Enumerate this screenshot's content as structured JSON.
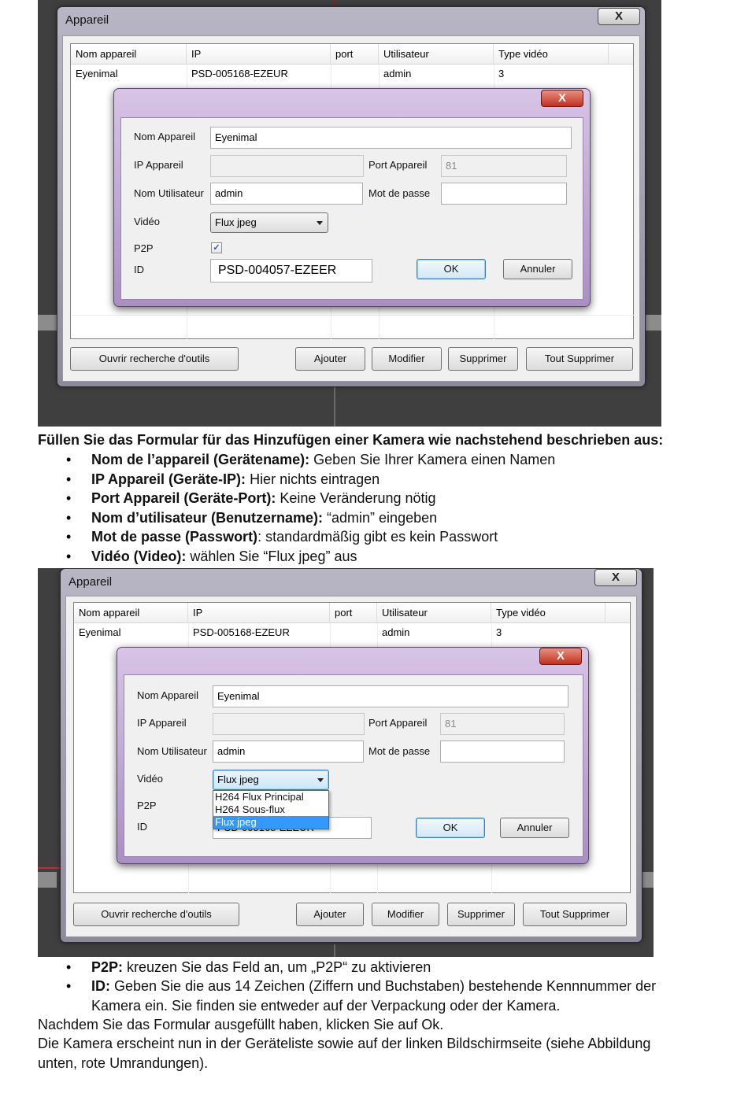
{
  "shot1": {
    "main_window": {
      "title": "Appareil",
      "close_glyph": "X",
      "columns": [
        "Nom appareil",
        "IP",
        "port",
        "Utilisateur",
        "Type vidéo"
      ],
      "row": [
        "Eyenimal",
        "PSD-005168-EZEUR",
        "",
        "admin",
        "3"
      ],
      "buttons": {
        "search": "Ouvrir recherche d'outils",
        "add": "Ajouter",
        "modify": "Modifier",
        "delete": "Supprimer",
        "delete_all": "Tout Supprimer"
      }
    },
    "dialog": {
      "close_glyph": "X",
      "labels": {
        "name": "Nom Appareil",
        "ip": "IP Appareil",
        "port": "Port Appareil",
        "user": "Nom Utilisateur",
        "password": "Mot de passe",
        "video": "Vidéo",
        "p2p": "P2P",
        "id": "ID"
      },
      "values": {
        "name": "Eyenimal",
        "ip": "",
        "port": "81",
        "user": "admin",
        "password": "",
        "video": "Flux jpeg",
        "p2p_checked": "✓",
        "id": "PSD-004057-EZEER"
      },
      "buttons": {
        "ok": "OK",
        "cancel": "Annuler"
      }
    }
  },
  "instructions": {
    "intro": "Füllen Sie das Formular für das Hinzufügen einer Kamera wie nachstehend beschrieben aus:",
    "bullet_glyph": "•",
    "items": [
      {
        "bold": "Nom de l’appareil (Gerätename):",
        "rest": " Geben Sie Ihrer Kamera einen Namen"
      },
      {
        "bold": "IP Appareil (Geräte-IP):",
        "rest": " Hier nichts eintragen"
      },
      {
        "bold": "Port Appareil (Geräte-Port):",
        "rest": " Keine Veränderung nötig"
      },
      {
        "bold": "Nom d’utilisateur (Benutzername):",
        "rest": " “admin” eingeben"
      },
      {
        "bold": "Mot de passe (Passwort)",
        "rest": ": standardmäßig gibt es kein Passwort"
      },
      {
        "bold": "Vidéo (Video):",
        "rest": " wählen Sie “Flux jpeg” aus"
      }
    ]
  },
  "shot2": {
    "main_window": {
      "title": "Appareil",
      "close_glyph": "X",
      "columns": [
        "Nom appareil",
        "IP",
        "port",
        "Utilisateur",
        "Type vidéo"
      ],
      "row": [
        "Eyenimal",
        "PSD-005168-EZEUR",
        "",
        "admin",
        "3"
      ],
      "buttons": {
        "search": "Ouvrir recherche d'outils",
        "add": "Ajouter",
        "modify": "Modifier",
        "delete": "Supprimer",
        "delete_all": "Tout Supprimer"
      }
    },
    "dialog": {
      "close_glyph": "X",
      "labels": {
        "name": "Nom Appareil",
        "ip": "IP Appareil",
        "port": "Port Appareil",
        "user": "Nom Utilisateur",
        "password": "Mot de passe",
        "video": "Vidéo",
        "p2p": "P2P",
        "id": "ID"
      },
      "values": {
        "name": "Eyenimal",
        "ip": "",
        "port": "81",
        "user": "admin",
        "password": "",
        "video": "Flux jpeg",
        "id": "PSD-005168-EZEUR"
      },
      "video_options": [
        "H264 Flux Principal",
        "H264 Sous-flux",
        "Flux jpeg"
      ],
      "selected_option": "Flux jpeg",
      "buttons": {
        "ok": "OK",
        "cancel": "Annuler"
      }
    }
  },
  "instructions2": {
    "bullet_glyph": "•",
    "items": [
      {
        "bold": "P2P:",
        "rest": " kreuzen Sie das Feld an, um „P2P“ zu aktivieren"
      },
      {
        "bold": "ID:",
        "rest": " Geben Sie die aus 14 Zeichen (Ziffern und Buchstaben) bestehende Kennnummer der",
        "rest2": "Kamera ein. Sie finden sie entweder auf der Verpackung oder der Kamera."
      }
    ],
    "para1": "Nachdem Sie das Formular ausgefüllt haben, klicken Sie auf Ok.",
    "para2_line1": "Die Kamera erscheint nun in der Geräteliste sowie auf der linken Bildschirmseite (siehe Abbildung",
    "para2_line2": "unten, rote Umrandungen)."
  }
}
